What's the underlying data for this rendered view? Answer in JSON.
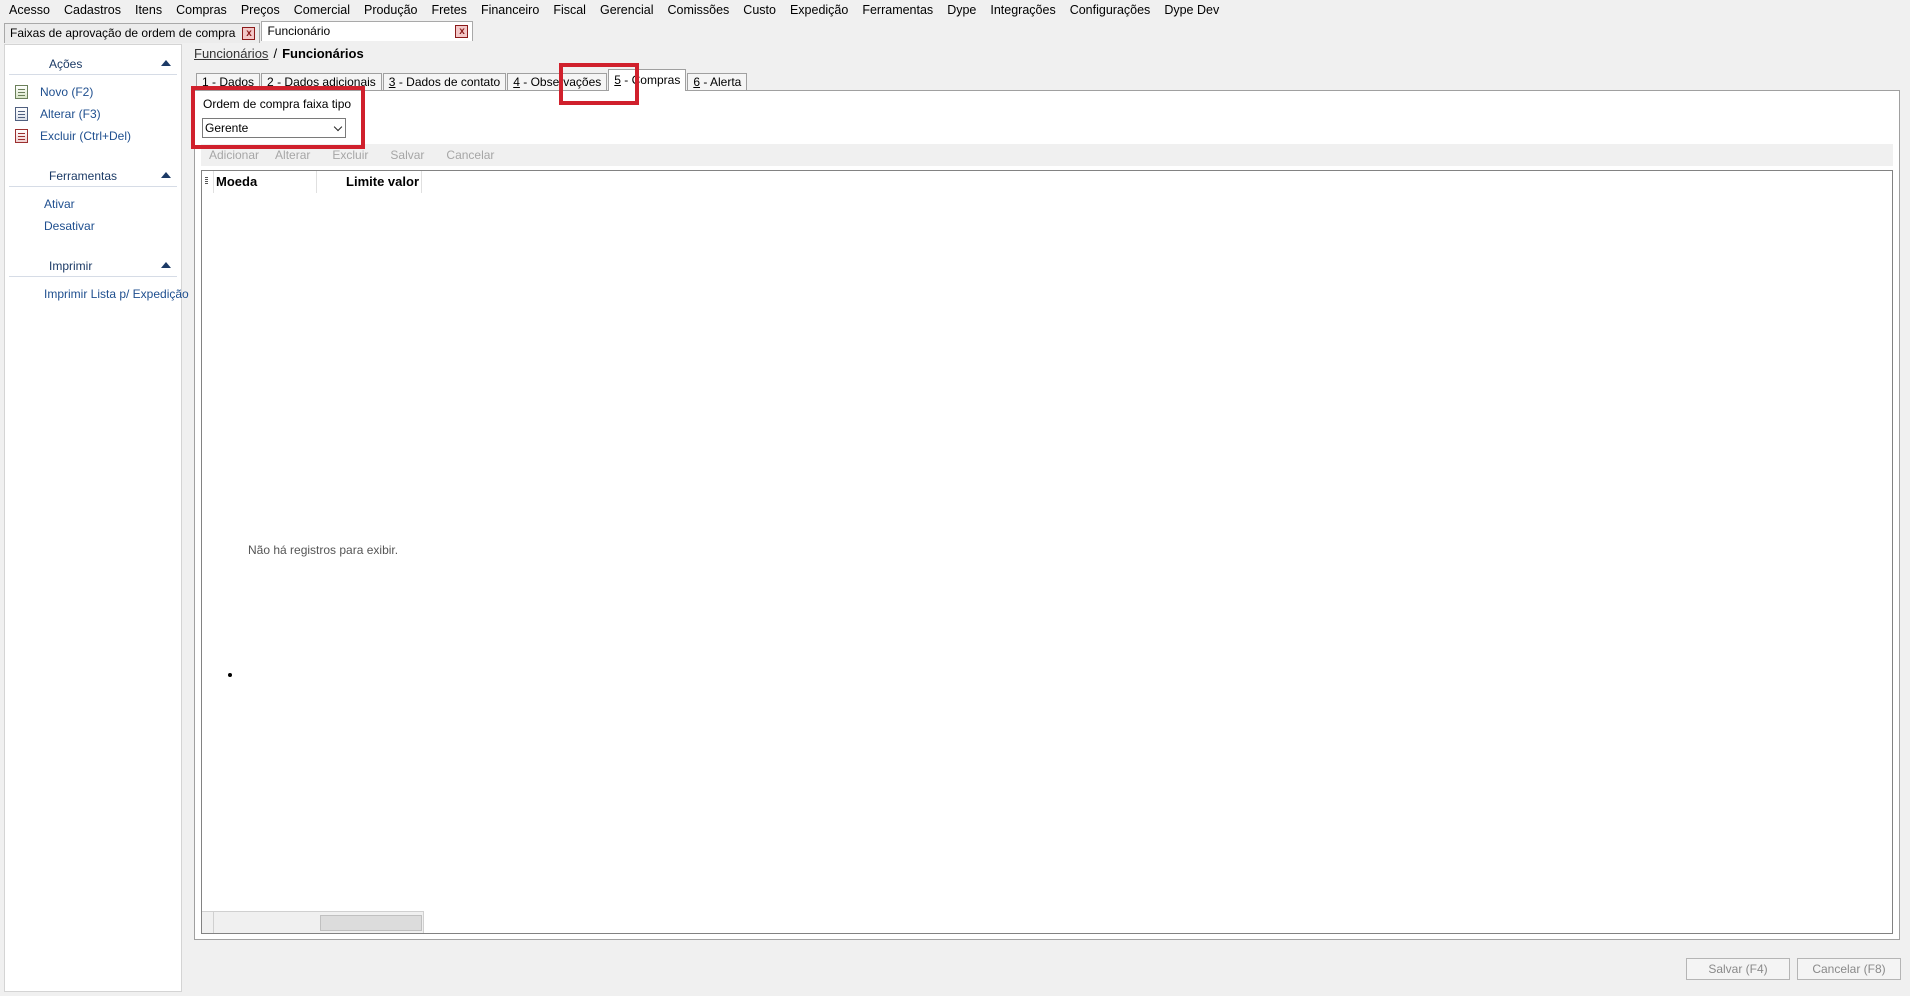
{
  "menu": [
    "Acesso",
    "Cadastros",
    "Itens",
    "Compras",
    "Preços",
    "Comercial",
    "Produção",
    "Fretes",
    "Financeiro",
    "Fiscal",
    "Gerencial",
    "Comissões",
    "Custo",
    "Expedição",
    "Ferramentas",
    "Dype",
    "Integrações",
    "Configurações",
    "Dype Dev"
  ],
  "doc_tabs": [
    {
      "label": "Faixas de aprovação de ordem de compra",
      "close": "x"
    },
    {
      "label": "Funcionário",
      "close": "x"
    }
  ],
  "sidebar": {
    "acoes": {
      "title": "Ações",
      "items": [
        "Novo (F2)",
        "Alterar (F3)",
        "Excluir (Ctrl+Del)"
      ]
    },
    "ferramentas": {
      "title": "Ferramentas",
      "items": [
        "Ativar",
        "Desativar"
      ]
    },
    "imprimir": {
      "title": "Imprimir",
      "items": [
        "Imprimir Lista p/ Expedição"
      ]
    }
  },
  "breadcrumb": {
    "link": "Funcionários",
    "separator": "/",
    "current": "Funcionários"
  },
  "tabs": [
    {
      "num": "1",
      "label": " - Dados"
    },
    {
      "num": "2",
      "label": " - Dados adicionais"
    },
    {
      "num": "3",
      "label": " - Dados de contato"
    },
    {
      "num": "4",
      "label": " - Observações"
    },
    {
      "num": "5",
      "label": " - Compras"
    },
    {
      "num": "6",
      "label": " - Alerta"
    }
  ],
  "active_tab": 4,
  "form": {
    "label": "Ordem de compra faixa tipo",
    "value": "Gerente"
  },
  "grid_toolbar": [
    "Adicionar",
    "Alterar",
    "Excluir",
    "Salvar",
    "Cancelar"
  ],
  "grid": {
    "columns": [
      "Moeda",
      "Limite valor"
    ],
    "empty_message": "Não há registros para exibir."
  },
  "footer": {
    "save": "Salvar (F4)",
    "cancel": "Cancelar (F8)"
  },
  "colors": {
    "highlight": "#d0202c",
    "link": "#1f4f8f",
    "header": "#1b3a66"
  }
}
